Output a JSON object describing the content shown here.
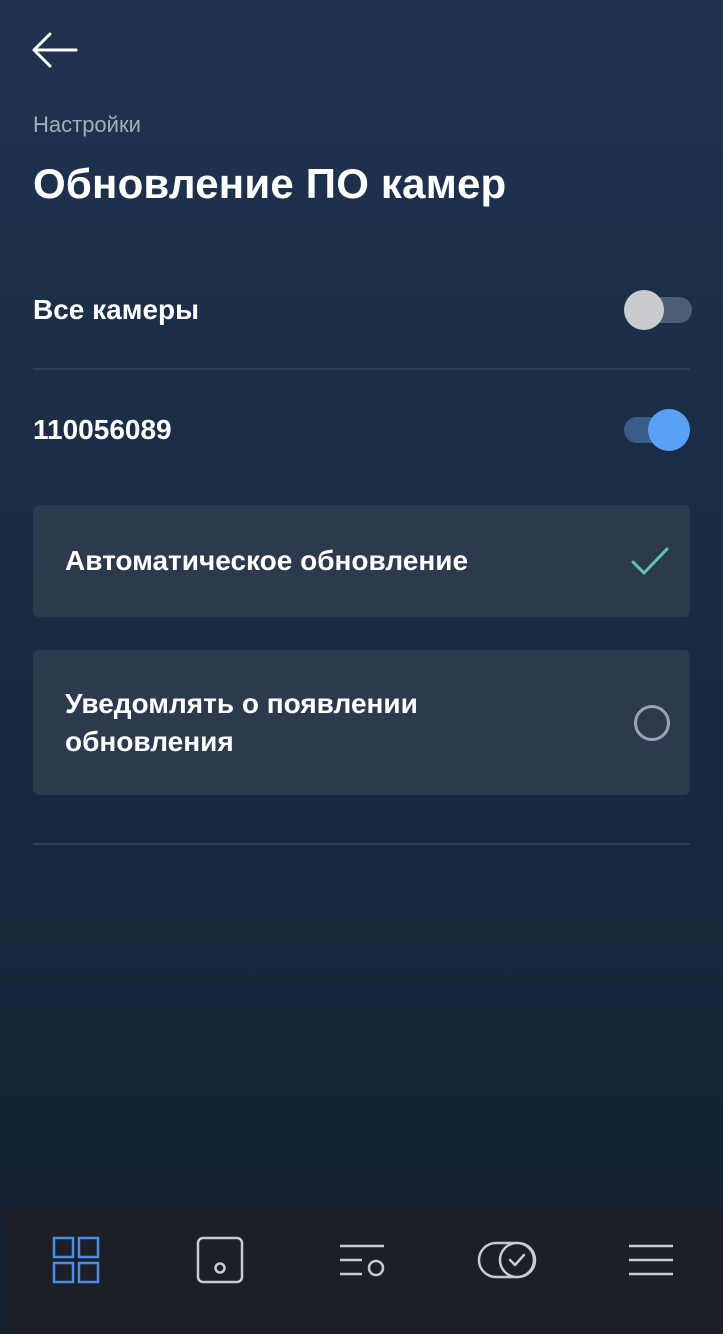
{
  "header": {
    "back_icon": "arrow-left-icon",
    "breadcrumb": "Настройки",
    "title": "Обновление ПО камер"
  },
  "settings": {
    "all_cameras": {
      "label": "Все камеры",
      "enabled": false
    },
    "camera": {
      "label": "110056089",
      "enabled": true
    }
  },
  "options": [
    {
      "label": "Автоматическое обновление",
      "selected": true,
      "icon": "checkmark-icon"
    },
    {
      "label": "Уведомлять о появлении обновления",
      "selected": false,
      "icon": "radio-circle-icon"
    }
  ],
  "bottom_nav": [
    {
      "icon": "grid-icon",
      "active": true
    },
    {
      "icon": "camera-icon",
      "active": false
    },
    {
      "icon": "events-list-icon",
      "active": false
    },
    {
      "icon": "toggle-check-icon",
      "active": false
    },
    {
      "icon": "menu-icon",
      "active": false
    }
  ],
  "colors": {
    "accent": "#5aa1f5",
    "check": "#5fc4a8",
    "nav_active": "#4a8fe8",
    "nav_inactive": "#c8ccd2"
  }
}
